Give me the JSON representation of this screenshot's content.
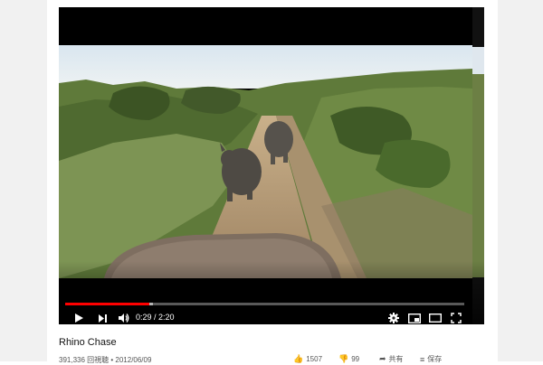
{
  "video": {
    "title": "Rhino Chase",
    "current_time": "0:29",
    "separator": " / ",
    "duration": "2:20",
    "played_fraction": 0.21,
    "loaded_fraction": 0.22
  },
  "meta": {
    "views": "391,336 回視聴",
    "dot": " • ",
    "date": "2012/06/09"
  },
  "actions": {
    "like_count": "1507",
    "dislike_count": "99",
    "share_label": "共有",
    "save_label": "保存"
  },
  "colors": {
    "progress_played": "#ff0000",
    "sky": "#dfe9f2",
    "grass": "#7d9454",
    "road": "#b59c79"
  },
  "icons": [
    "play-icon",
    "next-icon",
    "volume-icon",
    "settings-icon",
    "miniplayer-icon",
    "theater-icon",
    "fullscreen-icon",
    "like-icon",
    "dislike-icon",
    "share-icon",
    "save-icon"
  ]
}
